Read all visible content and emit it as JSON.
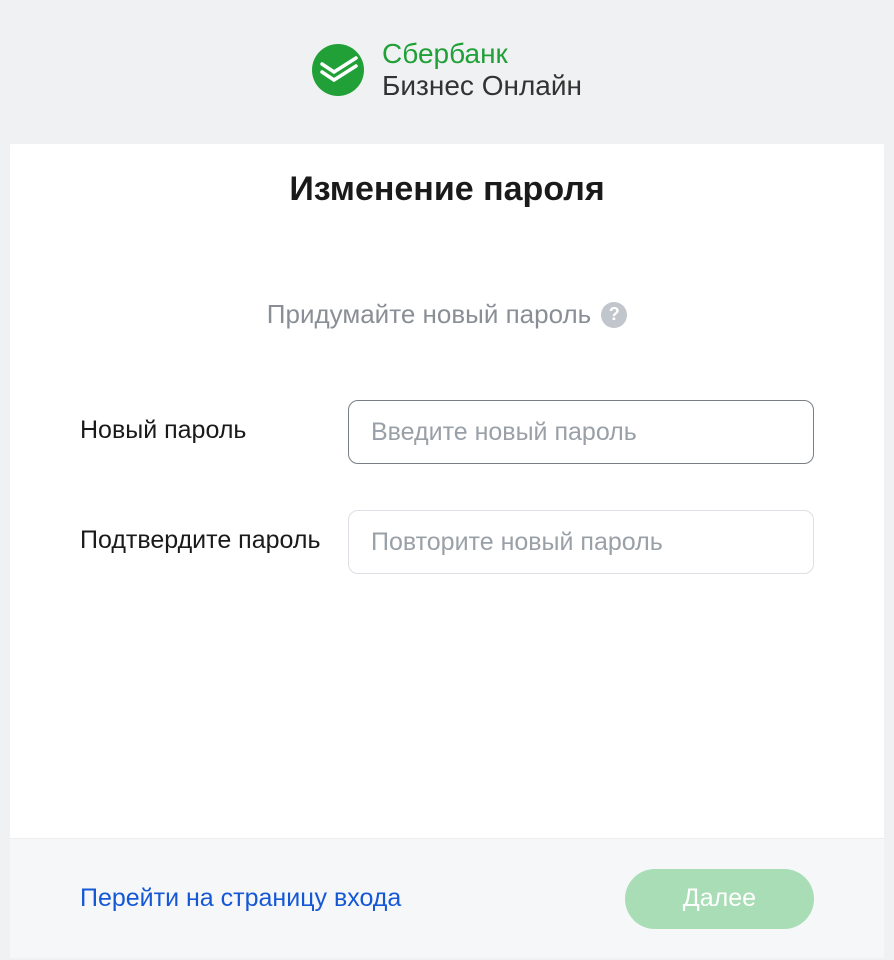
{
  "brand": {
    "name": "Сбербанк",
    "product": "Бизнес Онлайн",
    "color": "#21a038"
  },
  "page": {
    "title": "Изменение пароля",
    "subtitle": "Придумайте новый пароль"
  },
  "form": {
    "new_password": {
      "label": "Новый пароль",
      "placeholder": "Введите новый пароль",
      "value": ""
    },
    "confirm_password": {
      "label": "Подтвердите пароль",
      "placeholder": "Повторите новый пароль",
      "value": ""
    }
  },
  "footer": {
    "back_link": "Перейти на страницу входа",
    "next_button": "Далее"
  },
  "icons": {
    "help": "?"
  }
}
